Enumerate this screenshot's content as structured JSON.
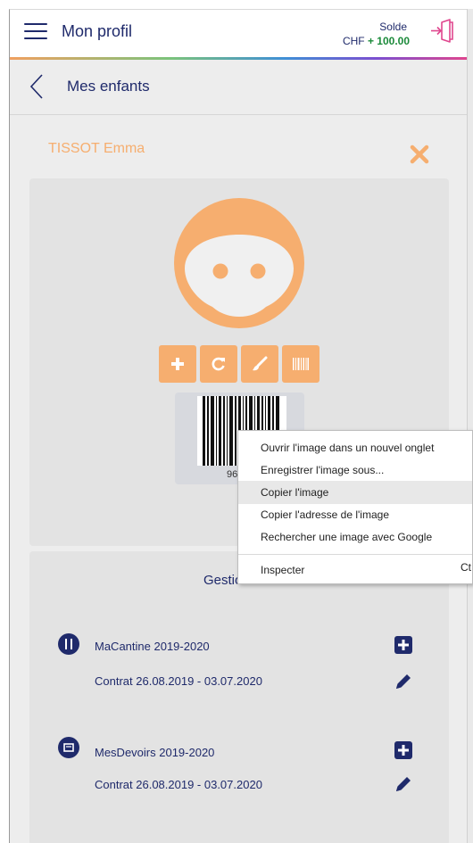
{
  "topbar": {
    "title": "Mon profil",
    "balance_label": "Solde",
    "balance_currency": "CHF",
    "balance_amount": "+ 100.00",
    "menu_icon": "hamburger-menu-icon",
    "logout_icon": "logout-icon"
  },
  "subbar": {
    "title": "Mes enfants",
    "back_icon": "chevron-left-icon"
  },
  "child": {
    "name": "TISSOT Emma",
    "close_icon": "close-icon",
    "avatar_icon": "child-face-icon",
    "actions": [
      "plus-icon",
      "refresh-icon",
      "brush-icon",
      "barcode-icon"
    ],
    "barcode_number": "96"
  },
  "services": {
    "title": "Gestion des",
    "items": [
      {
        "name": "MaCantine 2019-2020",
        "contract": "Contrat 26.08.2019 - 03.07.2020",
        "icon": "cutlery-icon"
      },
      {
        "name": "MesDevoirs 2019-2020",
        "contract": "Contrat 26.08.2019 - 03.07.2020",
        "icon": "homework-icon"
      }
    ]
  },
  "context_menu": {
    "items": [
      "Ouvrir l'image dans un nouvel onglet",
      "Enregistrer l'image sous...",
      "Copier l'image",
      "Copier l'adresse de l'image",
      "Rechercher une image avec Google",
      "Inspecter"
    ],
    "highlighted_index": 2,
    "inspect_shortcut": "Ct"
  },
  "colors": {
    "navy": "#1f2a6b",
    "orange": "#f6ae6f",
    "green": "#1b8a3a",
    "logout_pink": "#e0468e"
  }
}
